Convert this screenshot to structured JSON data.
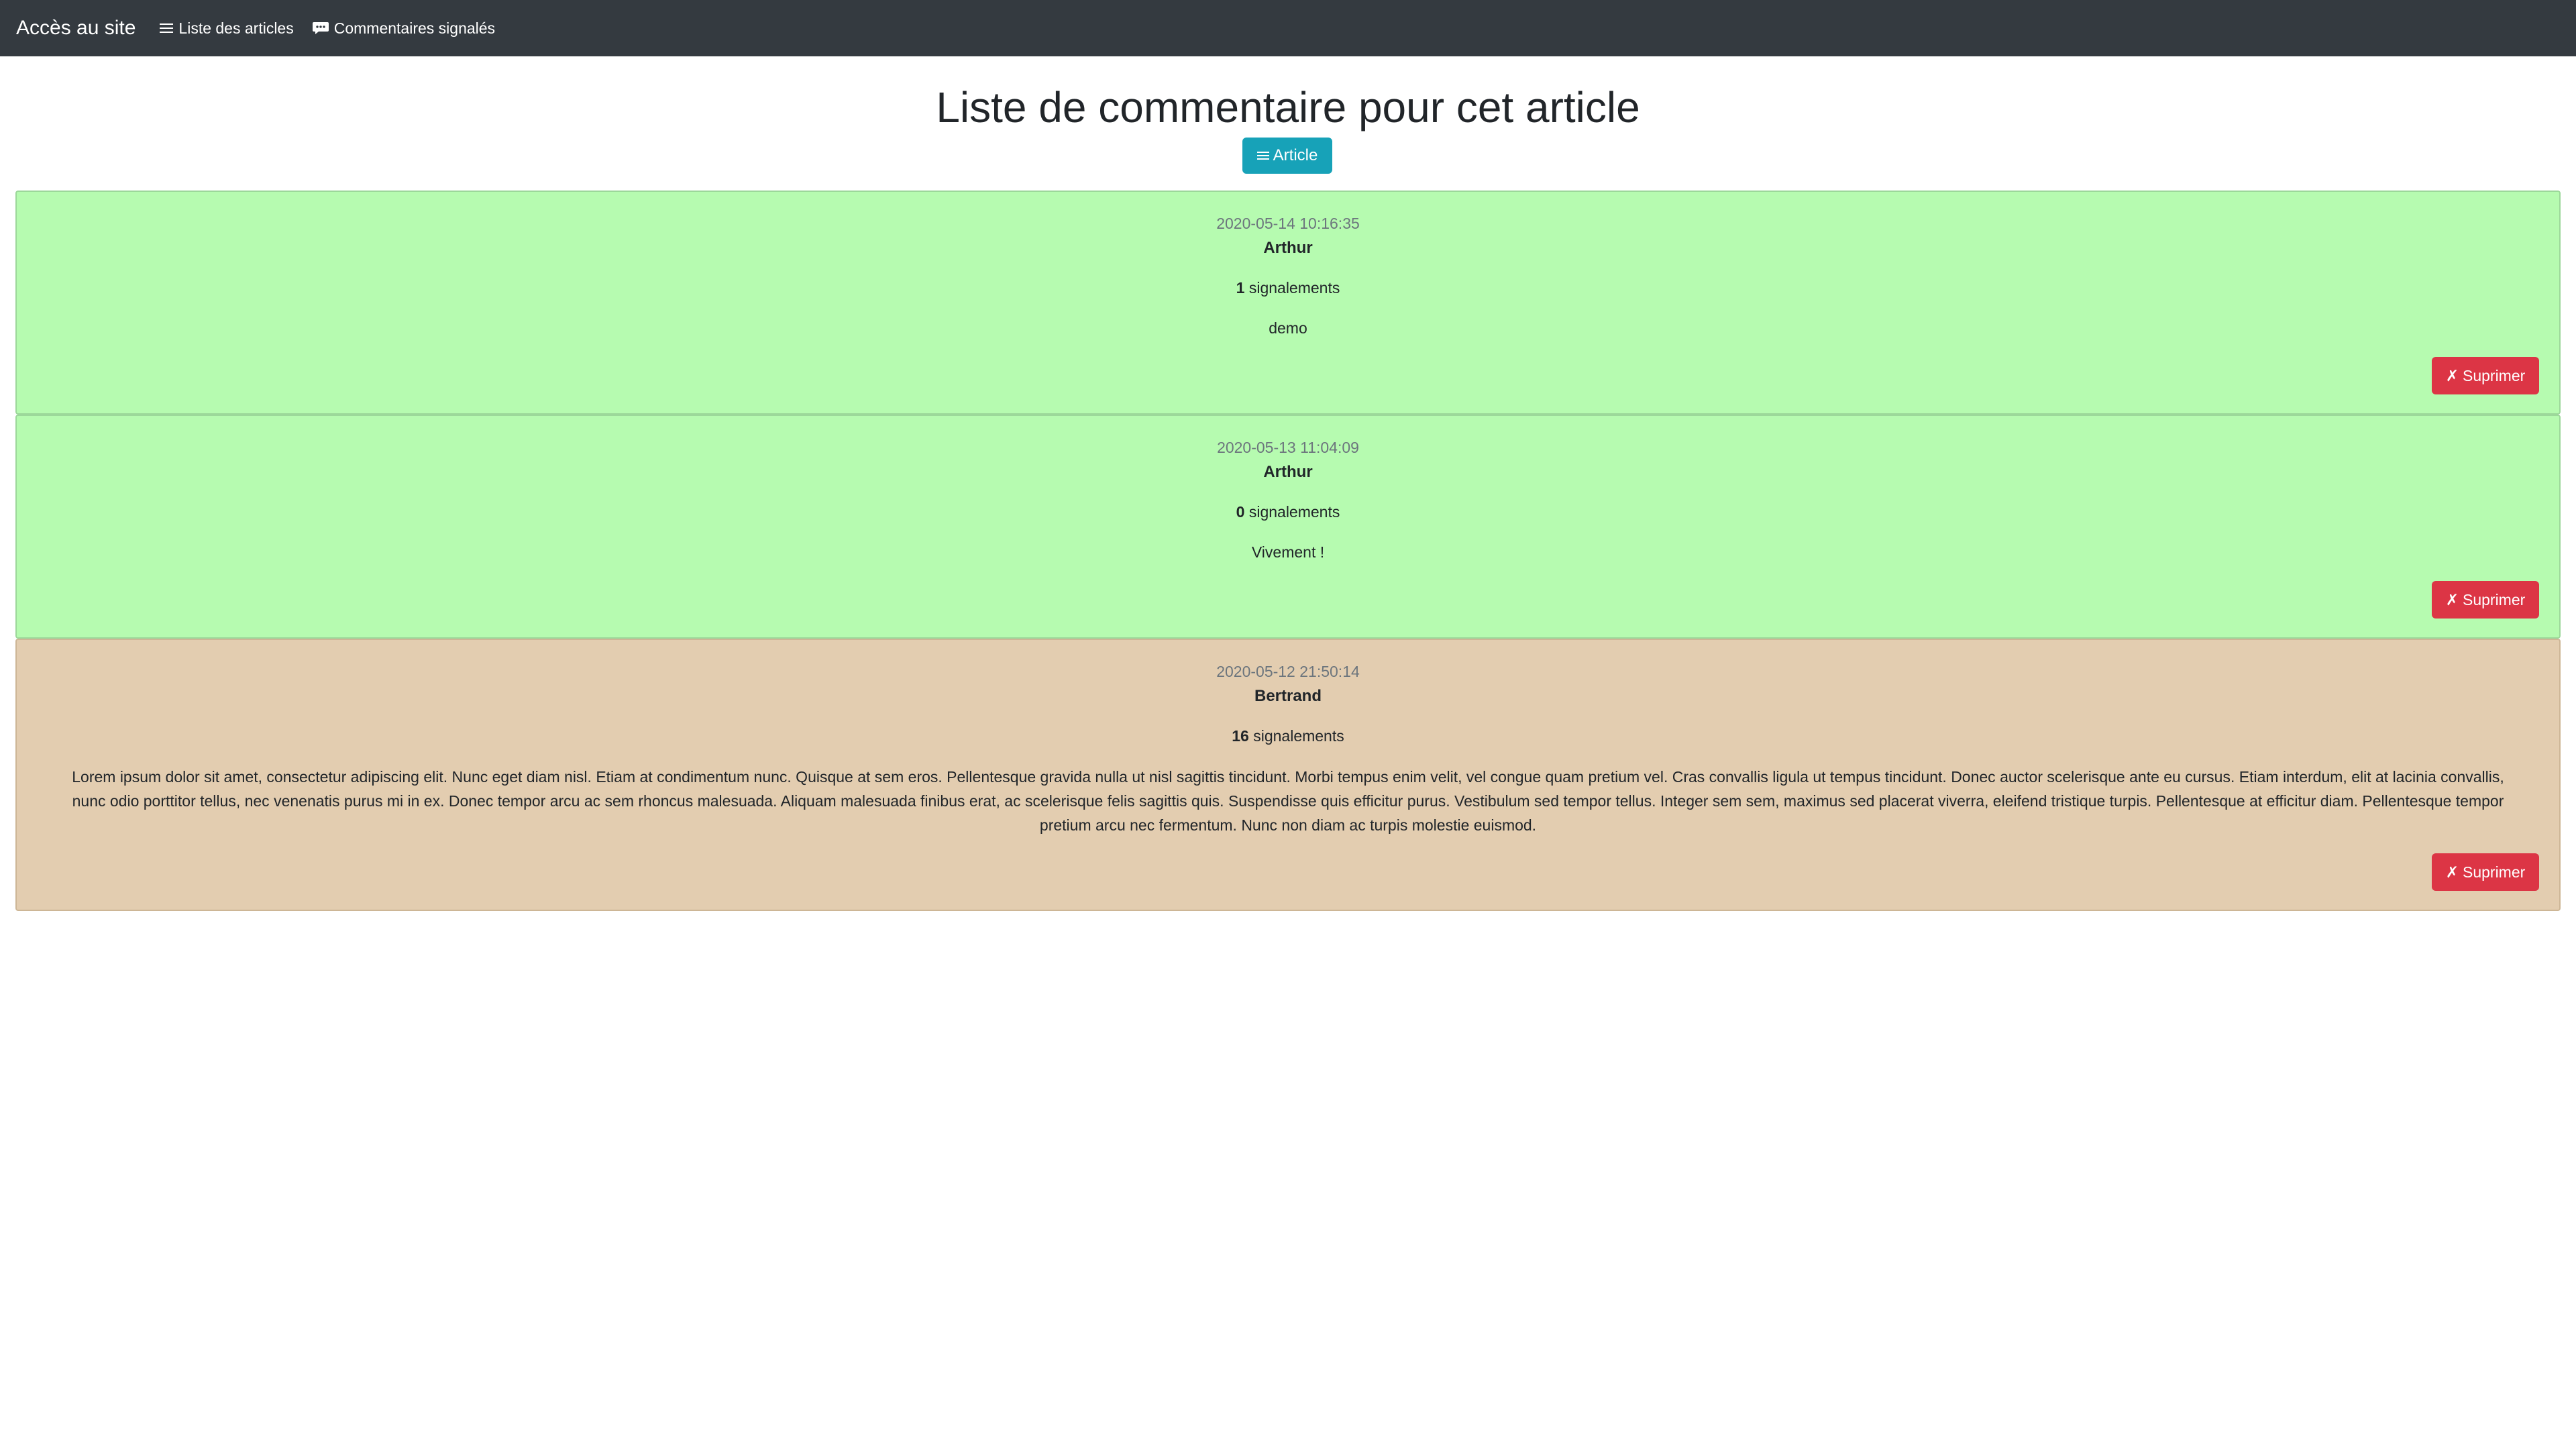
{
  "navbar": {
    "brand": "Accès au site",
    "links": [
      {
        "label": "Liste des articles",
        "icon": "list-icon"
      },
      {
        "label": "Commentaires signalés",
        "icon": "comment-dots-icon"
      }
    ]
  },
  "main": {
    "title": "Liste de commentaire pour cet article",
    "article_button": {
      "label": "Article",
      "icon": "list-icon"
    }
  },
  "comments": [
    {
      "date": "2020-05-14 10:16:35",
      "author": "Arthur",
      "report_count": "1",
      "report_label": "signalements",
      "text": "demo",
      "background": "#b6fbb0",
      "delete_label": "Suprimer"
    },
    {
      "date": "2020-05-13 11:04:09",
      "author": "Arthur",
      "report_count": "0",
      "report_label": "signalements",
      "text": "Vivement !",
      "background": "#b6fbb0",
      "delete_label": "Suprimer"
    },
    {
      "date": "2020-05-12 21:50:14",
      "author": "Bertrand",
      "report_count": "16",
      "report_label": "signalements",
      "text": "Lorem ipsum dolor sit amet, consectetur adipiscing elit. Nunc eget diam nisl. Etiam at condimentum nunc. Quisque at sem eros. Pellentesque gravida nulla ut nisl sagittis tincidunt. Morbi tempus enim velit, vel congue quam pretium vel. Cras convallis ligula ut tempus tincidunt. Donec auctor scelerisque ante eu cursus. Etiam interdum, elit at lacinia convallis, nunc odio porttitor tellus, nec venenatis purus mi in ex. Donec tempor arcu ac sem rhoncus malesuada. Aliquam malesuada finibus erat, ac scelerisque felis sagittis quis. Suspendisse quis efficitur purus. Vestibulum sed tempor tellus. Integer sem sem, maximus sed placerat viverra, eleifend tristique turpis. Pellentesque at efficitur diam. Pellentesque tempor pretium arcu nec fermentum. Nunc non diam ac turpis molestie euismod.",
      "background": "#e3cdb0",
      "delete_label": "Suprimer"
    }
  ],
  "colors": {
    "navbar": "#343a40",
    "info_button": "#17a2b8",
    "danger_button": "#dc3545"
  }
}
